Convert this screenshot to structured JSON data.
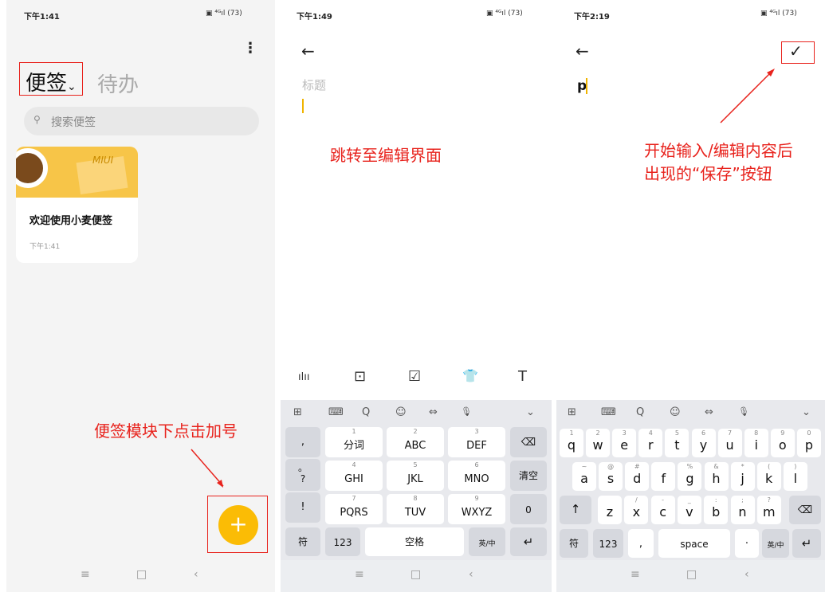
{
  "panel1": {
    "status_time": "下午1:41",
    "more_icon": "⋮",
    "tab_notes": "便签",
    "tab_notes_caret": "⌄",
    "tab_todo": "待办",
    "search_placeholder": "搜索便签",
    "card": {
      "image_text": "MIUI",
      "title": "欢迎使用小麦便签",
      "time": "下午1:41"
    },
    "fab_label": "+",
    "annotation": "便签模块下点击加号"
  },
  "panel2": {
    "status_time": "下午1:49",
    "back_icon": "←",
    "title_placeholder": "标题",
    "annotation": "跳转至编辑界面",
    "toolbar": [
      "ılıı",
      "⊡",
      "☑",
      "👕",
      "T"
    ],
    "kb_top": [
      "⊞",
      "⌨",
      "Q",
      "☺",
      "⇔",
      "🎙",
      "⌄"
    ],
    "left_col": [
      ",",
      "。\n?",
      "!"
    ],
    "rows": [
      [
        {
          "sub": "1",
          "main": "分词"
        },
        {
          "sub": "2",
          "main": "ABC"
        },
        {
          "sub": "3",
          "main": "DEF"
        }
      ],
      [
        {
          "sub": "4",
          "main": "GHI"
        },
        {
          "sub": "5",
          "main": "JKL"
        },
        {
          "sub": "6",
          "main": "MNO"
        }
      ],
      [
        {
          "sub": "7",
          "main": "PQRS"
        },
        {
          "sub": "8",
          "main": "TUV"
        },
        {
          "sub": "9",
          "main": "WXYZ"
        }
      ]
    ],
    "right_col": [
      "⌫",
      "清空",
      "0"
    ],
    "bottom": [
      "符",
      "123",
      "空格",
      "英/中",
      "↵"
    ]
  },
  "panel3": {
    "status_time": "下午2:19",
    "back_icon": "←",
    "save_icon": "✓",
    "typed_text": "p",
    "annotation_line1": "开始输入/编辑内容后",
    "annotation_line2": "出现的“保存”按钮",
    "kb_top": [
      "⊞",
      "⌨",
      "Q",
      "☺",
      "⇔",
      "🎙",
      "⌄"
    ],
    "row1": [
      {
        "sub": "1",
        "main": "q"
      },
      {
        "sub": "2",
        "main": "w"
      },
      {
        "sub": "3",
        "main": "e"
      },
      {
        "sub": "4",
        "main": "r"
      },
      {
        "sub": "5",
        "main": "t"
      },
      {
        "sub": "6",
        "main": "y"
      },
      {
        "sub": "7",
        "main": "u"
      },
      {
        "sub": "8",
        "main": "i"
      },
      {
        "sub": "9",
        "main": "o"
      },
      {
        "sub": "0",
        "main": "p"
      }
    ],
    "row2": [
      {
        "sub": "~",
        "main": "a"
      },
      {
        "sub": "@",
        "main": "s"
      },
      {
        "sub": "#",
        "main": "d"
      },
      {
        "sub": "",
        "main": "f"
      },
      {
        "sub": "%",
        "main": "g"
      },
      {
        "sub": "&",
        "main": "h"
      },
      {
        "sub": "*",
        "main": "j"
      },
      {
        "sub": "(",
        "main": "k"
      },
      {
        "sub": ")",
        "main": "l"
      }
    ],
    "row3": [
      {
        "sub": "",
        "main": "z"
      },
      {
        "sub": "/",
        "main": "x"
      },
      {
        "sub": "-",
        "main": "c"
      },
      {
        "sub": "_",
        "main": "v"
      },
      {
        "sub": ":",
        "main": "b"
      },
      {
        "sub": ";",
        "main": "n"
      },
      {
        "sub": "?",
        "main": "m"
      }
    ],
    "shift": "↑",
    "backspace": "⌫",
    "bottom": [
      "符",
      "123",
      ",",
      "space",
      "·",
      "英/中",
      "↵"
    ]
  },
  "navbar": [
    "≡",
    "□",
    "‹"
  ],
  "colors": {
    "accent": "#fbbc05",
    "annotation": "#e8231d",
    "cursor": "#f0b400"
  }
}
